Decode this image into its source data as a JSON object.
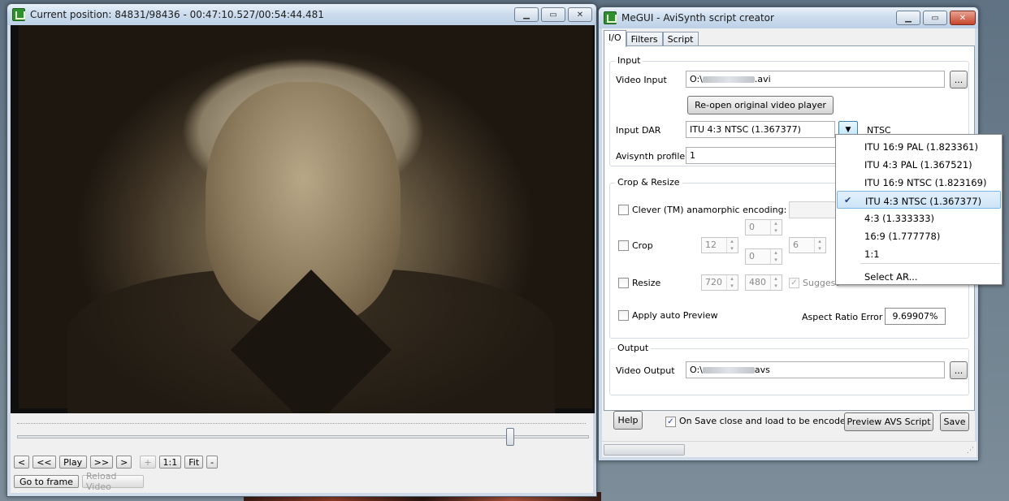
{
  "player": {
    "title": "Current position: 84831/98436   -   00:47:10.527/00:54:44.481",
    "seek_position": 0.862,
    "controls": {
      "prev_frame": "<",
      "rewind": "<<",
      "play": "Play",
      "forward": ">>",
      "next_frame": ">",
      "plus": "+",
      "one_to_one": "1:1",
      "fit": "Fit",
      "minus": "-",
      "go_to_frame": "Go to frame",
      "reload_video": "Reload Video"
    }
  },
  "megui": {
    "title": "MeGUI - AviSynth script creator",
    "tabs": [
      "I/O",
      "Filters",
      "Script"
    ],
    "input": {
      "group": "Input",
      "video_input_label": "Video Input",
      "video_input_prefix": "O:\\",
      "video_input_suffix": ".avi",
      "browse": "...",
      "reopen_button": "Re-open original video player",
      "dar_label": "Input DAR",
      "dar_value": "ITU 4:3 NTSC (1.367377)",
      "dar_standard": "NTSC",
      "profile_label": "Avisynth profile",
      "profile_value": "1"
    },
    "crop_resize": {
      "group": "Crop & Resize",
      "clever_label": "Clever (TM) anamorphic encoding:",
      "crop_label": "Crop",
      "crop_left": "12",
      "crop_top": "0",
      "crop_bottom": "0",
      "crop_right": "6",
      "resize_label": "Resize",
      "resize_width": "720",
      "resize_height": "480",
      "suggest_label": "Suggest",
      "auto_preview_label": "Apply auto Preview",
      "ar_error_label": "Aspect Ratio Error",
      "ar_error_value": "9.69907%"
    },
    "output": {
      "group": "Output",
      "video_output_label": "Video Output",
      "video_output_prefix": "O:\\",
      "video_output_suffix": "avs",
      "browse": "..."
    },
    "footer": {
      "help": "Help",
      "on_save_label": "On Save close and load to be encoded",
      "preview": "Preview AVS Script",
      "save": "Save"
    },
    "dar_options": [
      "ITU 16:9 PAL (1.823361)",
      "ITU 4:3 PAL (1.367521)",
      "ITU 16:9 NTSC (1.823169)",
      "ITU 4:3 NTSC (1.367377)",
      "4:3 (1.333333)",
      "16:9 (1.777778)",
      "1:1",
      "Select AR..."
    ],
    "dar_selected_index": 3
  },
  "icons": {
    "app": "megui-icon",
    "minimize": "minimize-icon",
    "maximize": "maximize-icon",
    "close": "close-icon"
  }
}
